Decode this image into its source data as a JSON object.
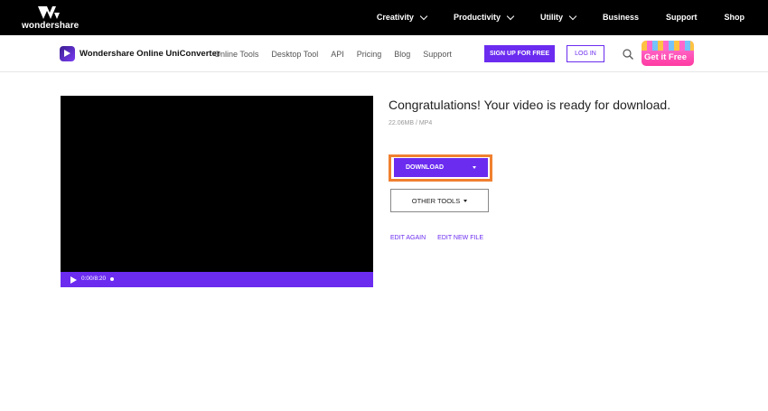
{
  "brand": {
    "name": "wondershare"
  },
  "topnav": [
    {
      "label": "Creativity",
      "has_menu": true
    },
    {
      "label": "Productivity",
      "has_menu": true
    },
    {
      "label": "Utility",
      "has_menu": true
    },
    {
      "label": "Business",
      "has_menu": false
    },
    {
      "label": "Support",
      "has_menu": false
    },
    {
      "label": "Shop",
      "has_menu": false
    }
  ],
  "product": {
    "name": "Wondershare Online UniConverter"
  },
  "subnav": [
    "Online Tools",
    "Desktop Tool",
    "API",
    "Pricing",
    "Blog",
    "Support"
  ],
  "signup_label": "SIGN UP FOR FREE",
  "login_label": "LOG IN",
  "promo_label": "Get it Free",
  "player": {
    "timecode": "0:00/8:20"
  },
  "result": {
    "title": "Congratulations! Your video is ready for download.",
    "file_info": "22.06MB / MP4",
    "download_label": "DOWNLOAD",
    "other_tools_label": "OTHER TOOLS",
    "edit_again_label": "EDIT AGAIN",
    "edit_new_label": "EDIT NEW FILE"
  },
  "colors": {
    "accent": "#6b2cf0",
    "highlight": "#f08030",
    "topbar": "#000000"
  }
}
